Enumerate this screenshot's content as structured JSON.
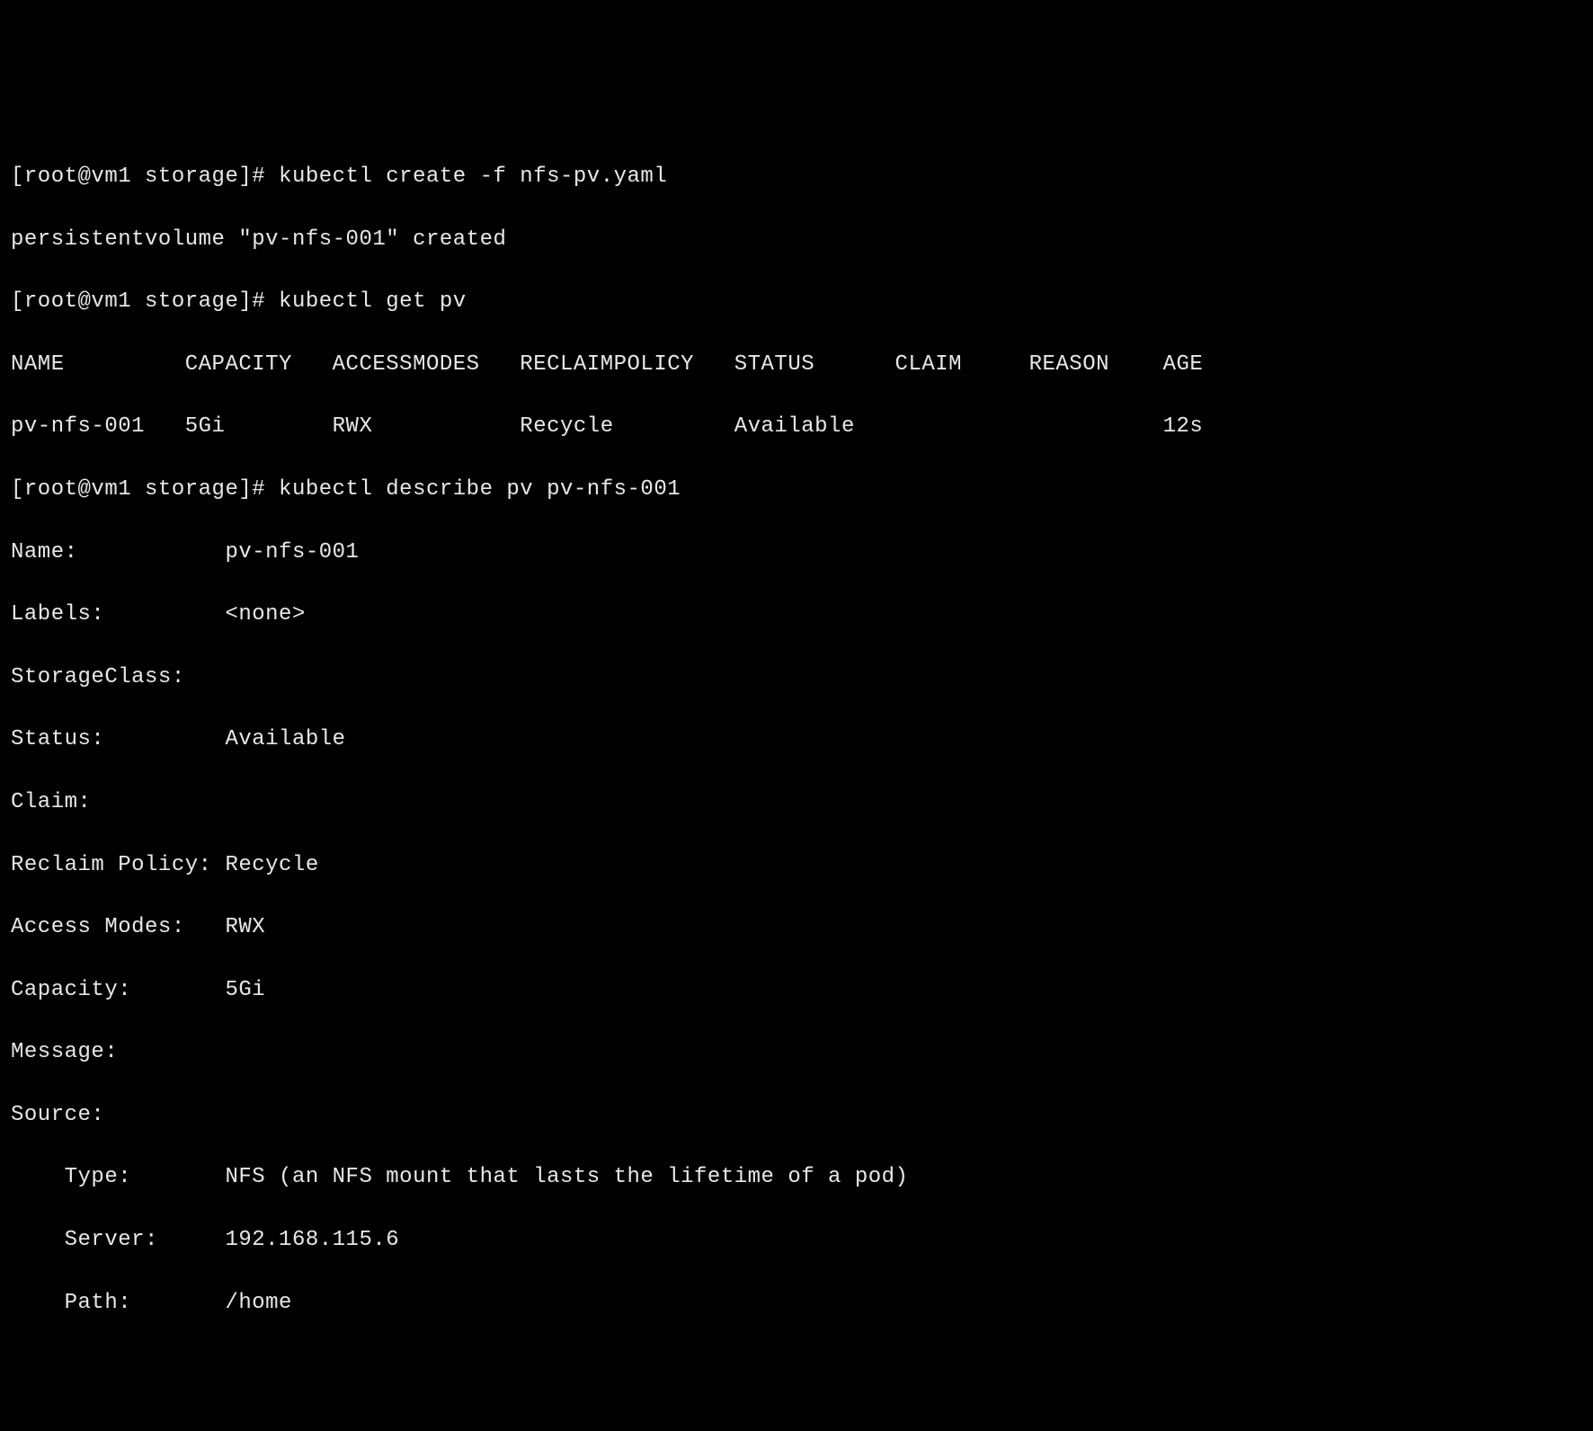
{
  "lines": [
    "[root@vm1 storage]# kubectl create -f nfs-pv.yaml",
    "persistentvolume \"pv-nfs-001\" created",
    "[root@vm1 storage]# kubectl get pv",
    "NAME         CAPACITY   ACCESSMODES   RECLAIMPOLICY   STATUS      CLAIM     REASON    AGE",
    "pv-nfs-001   5Gi        RWX           Recycle         Available                       12s",
    "[root@vm1 storage]# kubectl describe pv pv-nfs-001",
    "Name:           pv-nfs-001",
    "Labels:         <none>",
    "StorageClass:",
    "Status:         Available",
    "Claim:",
    "Reclaim Policy: Recycle",
    "Access Modes:   RWX",
    "Capacity:       5Gi",
    "Message:",
    "Source:",
    "    Type:       NFS (an NFS mount that lasts the lifetime of a pod)",
    "    Server:     192.168.115.6",
    "    Path:       /home"
  ]
}
